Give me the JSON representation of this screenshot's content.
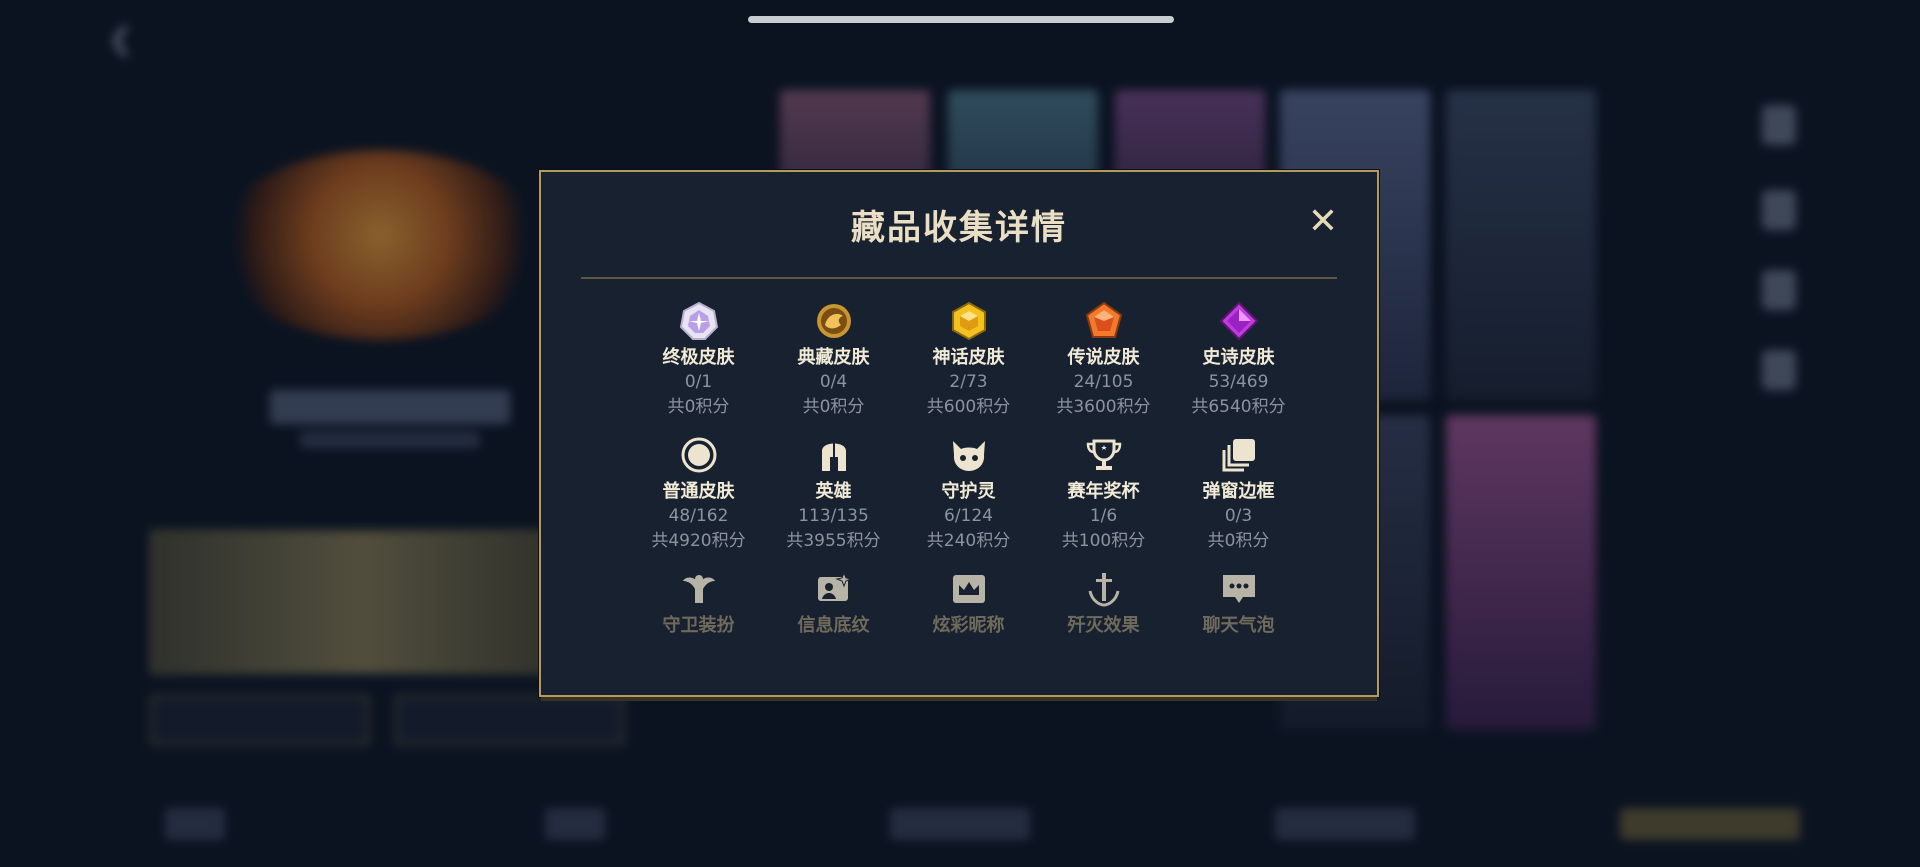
{
  "dialog": {
    "title": "藏品收集详情",
    "close_icon": "close-icon",
    "accent_color": "#b59a5e"
  },
  "categories": [
    {
      "label": "终极皮肤",
      "count": "0/1",
      "points": "共0积分",
      "icon": "ultimate-skin-icon"
    },
    {
      "label": "典藏皮肤",
      "count": "0/4",
      "points": "共0积分",
      "icon": "collection-skin-icon"
    },
    {
      "label": "神话皮肤",
      "count": "2/73",
      "points": "共600积分",
      "icon": "myth-skin-icon"
    },
    {
      "label": "传说皮肤",
      "count": "24/105",
      "points": "共3600积分",
      "icon": "legend-skin-icon"
    },
    {
      "label": "史诗皮肤",
      "count": "53/469",
      "points": "共6540积分",
      "icon": "epic-skin-icon"
    },
    {
      "label": "普通皮肤",
      "count": "48/162",
      "points": "共4920积分",
      "icon": "normal-skin-icon"
    },
    {
      "label": "英雄",
      "count": "113/135",
      "points": "共3955积分",
      "icon": "hero-helmet-icon"
    },
    {
      "label": "守护灵",
      "count": "6/124",
      "points": "共240积分",
      "icon": "guardian-spirit-icon"
    },
    {
      "label": "赛年奖杯",
      "count": "1/6",
      "points": "共100积分",
      "icon": "trophy-icon"
    },
    {
      "label": "弹窗边框",
      "count": "0/3",
      "points": "共0积分",
      "icon": "popup-frame-icon"
    },
    {
      "label": "守卫装扮",
      "icon": "guard-outfit-icon"
    },
    {
      "label": "信息底纹",
      "icon": "info-background-icon"
    },
    {
      "label": "炫彩昵称",
      "icon": "colorful-nickname-icon"
    },
    {
      "label": "歼灭效果",
      "icon": "annihilation-effect-icon"
    },
    {
      "label": "聊天气泡",
      "icon": "chat-bubble-icon"
    }
  ]
}
